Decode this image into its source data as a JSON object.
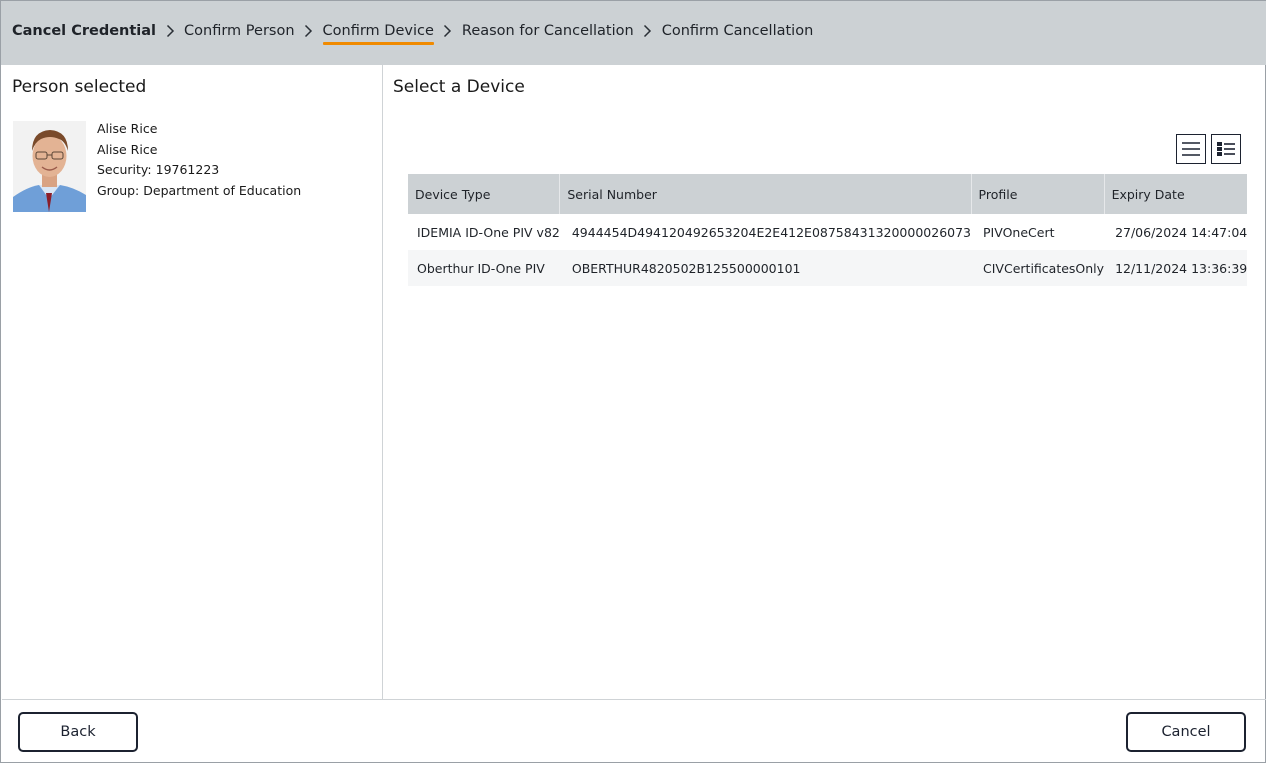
{
  "breadcrumb": {
    "items": [
      {
        "label": "Cancel Credential"
      },
      {
        "label": "Confirm Person"
      },
      {
        "label": "Confirm Device"
      },
      {
        "label": "Reason for Cancellation"
      },
      {
        "label": "Confirm Cancellation"
      }
    ],
    "active_index": 2,
    "accent_color": "#f08a00"
  },
  "left_panel": {
    "title": "Person selected",
    "person": {
      "name": "Alise Rice",
      "display_name": "Alise Rice",
      "security_label": "Security:",
      "security_value": "19761223",
      "group_label": "Group:",
      "group_value": "Department of Education"
    }
  },
  "right_panel": {
    "title": "Select a Device",
    "view_buttons": [
      {
        "icon": "list-view-icon"
      },
      {
        "icon": "details-view-icon"
      }
    ],
    "table": {
      "columns": [
        "Device Type",
        "Serial Number",
        "Profile",
        "Expiry Date"
      ],
      "rows": [
        [
          "IDEMIA ID-One PIV v82",
          "4944454D494120492653204E2E412E08758431320000026073",
          "PIVOneCert",
          "27/06/2024 14:47:04"
        ],
        [
          "Oberthur ID-One PIV",
          "OBERTHUR4820502B125500000101",
          "CIVCertificatesOnly",
          "12/11/2024 13:36:39"
        ]
      ]
    }
  },
  "footer": {
    "back_label": "Back",
    "cancel_label": "Cancel"
  }
}
